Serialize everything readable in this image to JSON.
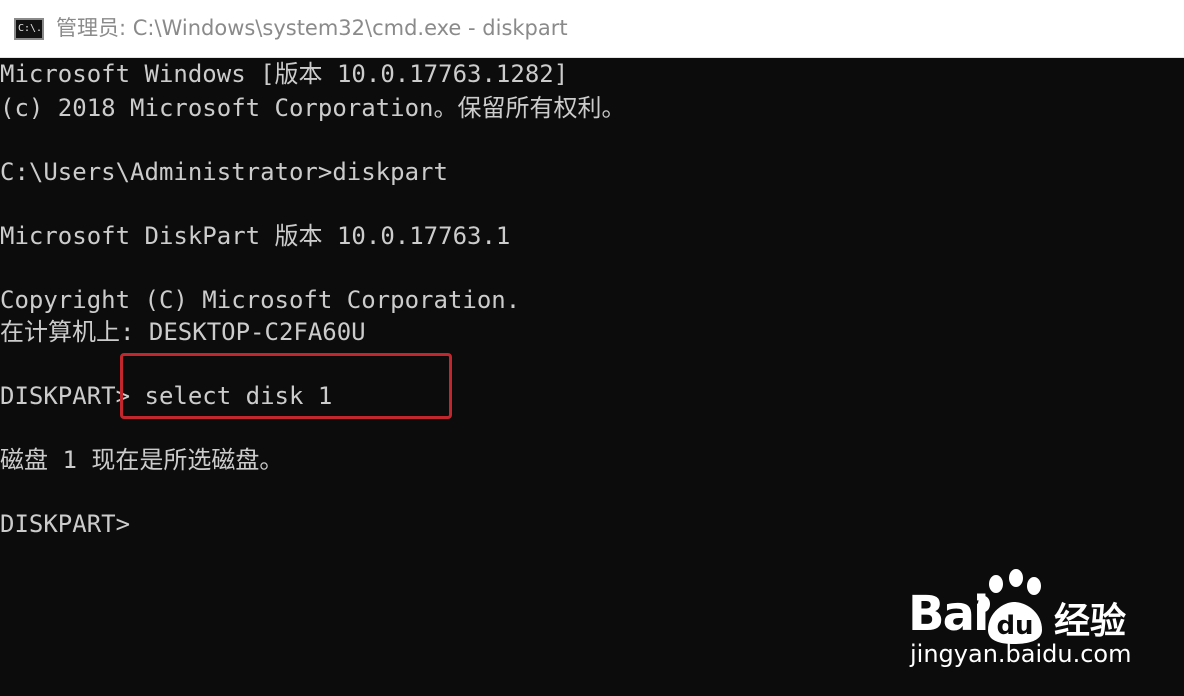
{
  "window": {
    "title": "管理员: C:\\Windows\\system32\\cmd.exe - diskpart",
    "icon_label": "C:\\."
  },
  "console": {
    "lines": [
      "Microsoft Windows [版本 10.0.17763.1282]",
      "(c) 2018 Microsoft Corporation。保留所有权利。",
      "",
      "C:\\Users\\Administrator>diskpart",
      "",
      "Microsoft DiskPart 版本 10.0.17763.1",
      "",
      "Copyright (C) Microsoft Corporation.",
      "在计算机上: DESKTOP-C2FA60U",
      "",
      "DISKPART> select disk 1",
      "",
      "磁盘 1 现在是所选磁盘。",
      "",
      "DISKPART>"
    ]
  },
  "highlight": {
    "color": "#c1272d",
    "target": "select disk 1"
  },
  "watermark": {
    "brand": "Bai",
    "paw_text": "du",
    "suffix": "经验",
    "url": "jingyan.baidu.com"
  },
  "colors": {
    "console_bg": "#0c0c0c",
    "console_text": "#cccccc",
    "titlebar_bg": "#ffffff",
    "title_text": "#8a8a8a"
  }
}
